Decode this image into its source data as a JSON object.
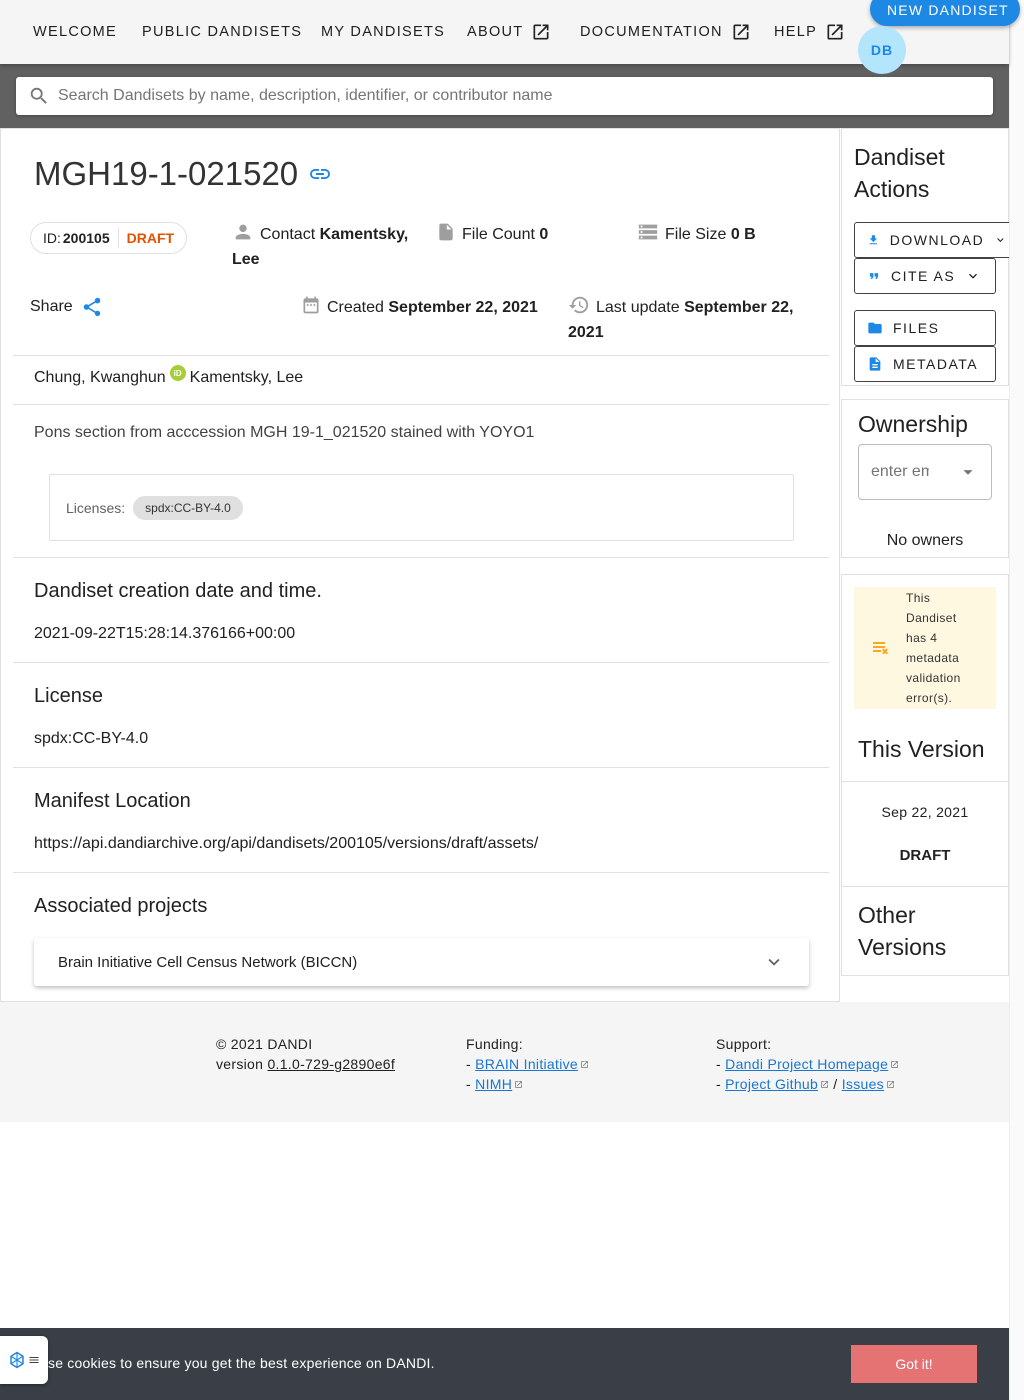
{
  "nav": {
    "items": [
      {
        "label": "WELCOME"
      },
      {
        "label": "PUBLIC DANDISETS"
      },
      {
        "label": "MY DANDISETS"
      },
      {
        "label": "ABOUT"
      },
      {
        "label": "DOCUMENTATION"
      },
      {
        "label": "HELP"
      }
    ],
    "new_button": "NEW DANDISET",
    "avatar_initials": "DB"
  },
  "search": {
    "placeholder": "Search Dandisets by name, description, identifier, or contributor name",
    "value": ""
  },
  "dandiset": {
    "title": "MGH19-1-021520",
    "id_label": "ID:",
    "id_value": "200105",
    "status": "DRAFT",
    "contact_label": "Contact",
    "contact_name_1": "Kamentsky,",
    "contact_name_2": "Lee",
    "file_count_label": "File Count",
    "file_count": "0",
    "file_size_label": "File Size",
    "file_size": "0 B",
    "share_label": "Share",
    "created_label": "Created",
    "created_date": "September 22, 2021",
    "updated_label": "Last update",
    "updated_date_1": "September 22,",
    "updated_date_2": "2021",
    "contributors": [
      "Chung, Kwanghun",
      "Kamentsky, Lee"
    ],
    "orcid_glyph": "iD",
    "description": "Pons section from acccession MGH 19-1_021520 stained with YOYO1",
    "licenses_label": "Licenses:",
    "license_chip": "spdx:CC-BY-4.0"
  },
  "sections": {
    "creation_title": "Dandiset creation date and time.",
    "creation_value": "2021-09-22T15:28:14.376166+00:00",
    "license_title": "License",
    "license_value": "spdx:CC-BY-4.0",
    "manifest_title": "Manifest Location",
    "manifest_value": "https://api.dandiarchive.org/api/dandisets/200105/versions/draft/assets/",
    "projects_title": "Associated projects",
    "project_item": "Brain Initiative Cell Census Network (BICCN)"
  },
  "actions": {
    "title_1": "Dandiset",
    "title_2": "Actions",
    "download": "DOWNLOAD",
    "cite_as": "CITE AS",
    "files": "FILES",
    "metadata": "METADATA"
  },
  "ownership": {
    "title": "Ownership",
    "placeholder": "enter email",
    "no_owners": "No owners"
  },
  "versions": {
    "warning_lines": [
      "This",
      "Dandiset",
      "has 4",
      "metadata",
      "validation",
      "error(s)."
    ],
    "this_version_title": "This Version",
    "version_date": "Sep 22, 2021",
    "version_name": "DRAFT",
    "other_title_1": "Other",
    "other_title_2": "Versions"
  },
  "footer": {
    "copyright": "© 2021 DANDI",
    "version_label": "version",
    "version_value": "0.1.0-729-g2890e6f",
    "funding_label": "Funding:",
    "funding_links": [
      "BRAIN Initiative",
      "NIMH"
    ],
    "support_label": "Support:",
    "support_links": [
      "Dandi Project Homepage",
      "Project Github",
      "Issues"
    ],
    "dash": "-",
    "slash": "/"
  },
  "cookie": {
    "message": "se cookies to ensure you get the best experience on DANDI.",
    "button": "Got it!"
  },
  "colors": {
    "primary": "#1e88e5",
    "draft": "#e65100",
    "warning": "#f9a825",
    "cookie_button": "#e57373"
  },
  "icons": [
    "open-in-new-icon",
    "search-icon",
    "link-icon",
    "person-icon",
    "file-icon",
    "storage-icon",
    "share-icon",
    "calendar-icon",
    "history-icon",
    "orcid-icon",
    "chevron-down-icon",
    "download-icon",
    "quote-icon",
    "folder-icon",
    "document-icon",
    "dropdown-arrow-icon",
    "playlist-remove-icon",
    "external-link-icon",
    "cookie-widget-icon"
  ]
}
